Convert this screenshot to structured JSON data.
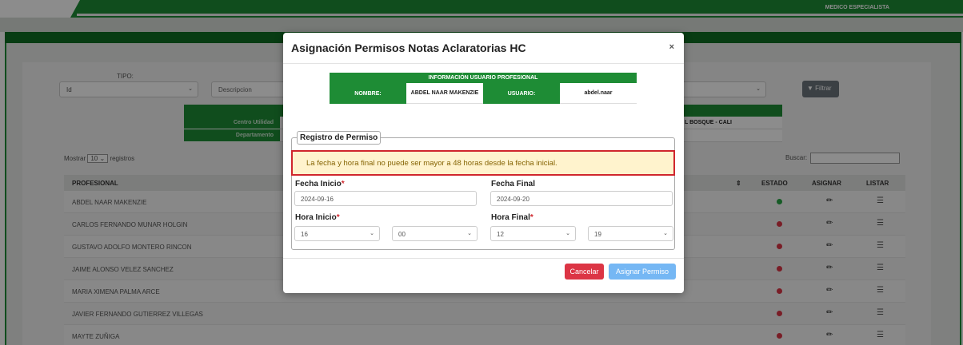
{
  "header": {
    "role": "MEDICO ESPECIALISTA"
  },
  "filters": {
    "tipo_label": "TIPO:",
    "tipo_value": "Id",
    "descripcion_placeholder": "Descripcion",
    "filtrar_label": "Filtrar"
  },
  "info_table": {
    "centro_label": "Centro Utilidad",
    "departamento_label": "Departamento",
    "bosque_value": "L BOSQUE - CALI"
  },
  "table_controls": {
    "mostrar_prefix": "Mostrar",
    "mostrar_value": "10",
    "mostrar_suffix": "registros",
    "buscar_label": "Buscar:"
  },
  "table": {
    "columns": {
      "profesional": "PROFESIONAL",
      "estado": "ESTADO",
      "asignar": "ASIGNAR",
      "listar": "LISTAR"
    },
    "rows": [
      {
        "name": "ABDEL NAAR MAKENZIE",
        "status_color": "#28a745"
      },
      {
        "name": "CARLOS FERNANDO MUNAR HOLGIN",
        "status_color": "#dc3545"
      },
      {
        "name": "GUSTAVO ADOLFO MONTERO RINCON",
        "status_color": "#dc3545"
      },
      {
        "name": "JAIME ALONSO VELEZ SANCHEZ",
        "status_color": "#dc3545"
      },
      {
        "name": "MARIA XIMENA PALMA ARCE",
        "status_color": "#dc3545"
      },
      {
        "name": "JAVIER FERNANDO GUTIERREZ VILLEGAS",
        "status_color": "#dc3545"
      },
      {
        "name": "MAYTE ZUÑIGA",
        "status_color": "#dc3545"
      }
    ]
  },
  "modal": {
    "title": "Asignación Permisos Notas Aclaratorias HC",
    "close": "×",
    "user_info": {
      "header": "INFORMACIÓN USUARIO PROFESIONAL",
      "nombre_label": "NOMBRE:",
      "nombre_value": "ABDEL NAAR MAKENZIE",
      "usuario_label": "USUARIO:",
      "usuario_value": "abdel.naar"
    },
    "fieldset_legend": "Registro de Permiso",
    "alert": "La fecha y hora final no puede ser mayor a 48 horas desde la fecha inicial.",
    "fecha_inicio_label": "Fecha Inicio",
    "fecha_inicio_value": "2024-09-16",
    "fecha_final_label": "Fecha Final",
    "fecha_final_value": "2024-09-20",
    "hora_inicio_label": "Hora Inicio",
    "hora_inicio_hour": "16",
    "hora_inicio_min": "00",
    "hora_final_label": "Hora Final",
    "hora_final_hour": "12",
    "hora_final_min": "19",
    "cancel_label": "Cancelar",
    "assign_label": "Asignar Permiso"
  }
}
